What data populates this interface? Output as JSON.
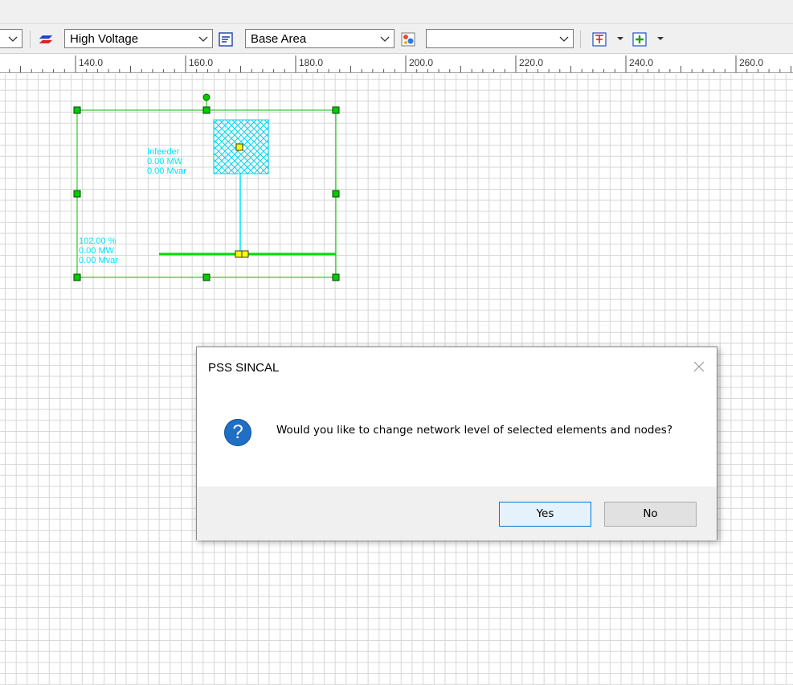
{
  "toolbar": {
    "network_level": "High Voltage",
    "area": "Base Area",
    "third_combo": ""
  },
  "ruler": {
    "labels": [
      "140.0",
      "160.0",
      "180.0",
      "200.0",
      "220.0",
      "240.0",
      "260.0"
    ]
  },
  "network": {
    "infeeder": {
      "name": "Infeeder",
      "p": "0.00 MW",
      "q": "0.00 Mvar"
    },
    "node": {
      "voltage": "102.00 %",
      "p": "0.00 MW",
      "q": "0.00 Mvar"
    }
  },
  "dialog": {
    "title": "PSS SINCAL",
    "message": "Would you like to change network level of selected elements and nodes?",
    "icon": "question-icon",
    "yes_label": "Yes",
    "no_label": "No"
  },
  "colors": {
    "selection": "#00c000",
    "element": "#00e5ff",
    "busbar": "#00dd00",
    "accent": "#0078d7"
  }
}
